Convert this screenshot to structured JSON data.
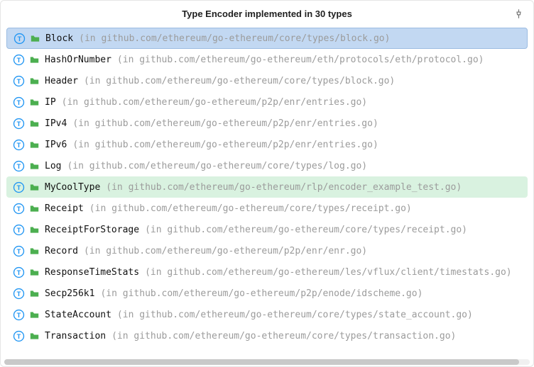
{
  "header": {
    "title": "Type Encoder implemented in 30 types"
  },
  "rows": [
    {
      "name": "Block",
      "path": "(in github.com/ethereum/go-ethereum/core/types/block.go)",
      "state": "selected"
    },
    {
      "name": "HashOrNumber",
      "path": "(in github.com/ethereum/go-ethereum/eth/protocols/eth/protocol.go)",
      "state": "normal"
    },
    {
      "name": "Header",
      "path": "(in github.com/ethereum/go-ethereum/core/types/block.go)",
      "state": "normal"
    },
    {
      "name": "IP",
      "path": "(in github.com/ethereum/go-ethereum/p2p/enr/entries.go)",
      "state": "normal"
    },
    {
      "name": "IPv4",
      "path": "(in github.com/ethereum/go-ethereum/p2p/enr/entries.go)",
      "state": "normal"
    },
    {
      "name": "IPv6",
      "path": "(in github.com/ethereum/go-ethereum/p2p/enr/entries.go)",
      "state": "normal"
    },
    {
      "name": "Log",
      "path": "(in github.com/ethereum/go-ethereum/core/types/log.go)",
      "state": "normal"
    },
    {
      "name": "MyCoolType",
      "path": "(in github.com/ethereum/go-ethereum/rlp/encoder_example_test.go)",
      "state": "highlighted"
    },
    {
      "name": "Receipt",
      "path": "(in github.com/ethereum/go-ethereum/core/types/receipt.go)",
      "state": "normal"
    },
    {
      "name": "ReceiptForStorage",
      "path": "(in github.com/ethereum/go-ethereum/core/types/receipt.go)",
      "state": "normal"
    },
    {
      "name": "Record",
      "path": "(in github.com/ethereum/go-ethereum/p2p/enr/enr.go)",
      "state": "normal"
    },
    {
      "name": "ResponseTimeStats",
      "path": "(in github.com/ethereum/go-ethereum/les/vflux/client/timestats.go)",
      "state": "normal"
    },
    {
      "name": "Secp256k1",
      "path": "(in github.com/ethereum/go-ethereum/p2p/enode/idscheme.go)",
      "state": "normal"
    },
    {
      "name": "StateAccount",
      "path": "(in github.com/ethereum/go-ethereum/core/types/state_account.go)",
      "state": "normal"
    },
    {
      "name": "Transaction",
      "path": "(in github.com/ethereum/go-ethereum/core/types/transaction.go)",
      "state": "normal"
    }
  ],
  "colors": {
    "type_icon": "#2196f3",
    "pkg_icon": "#4caf50"
  }
}
